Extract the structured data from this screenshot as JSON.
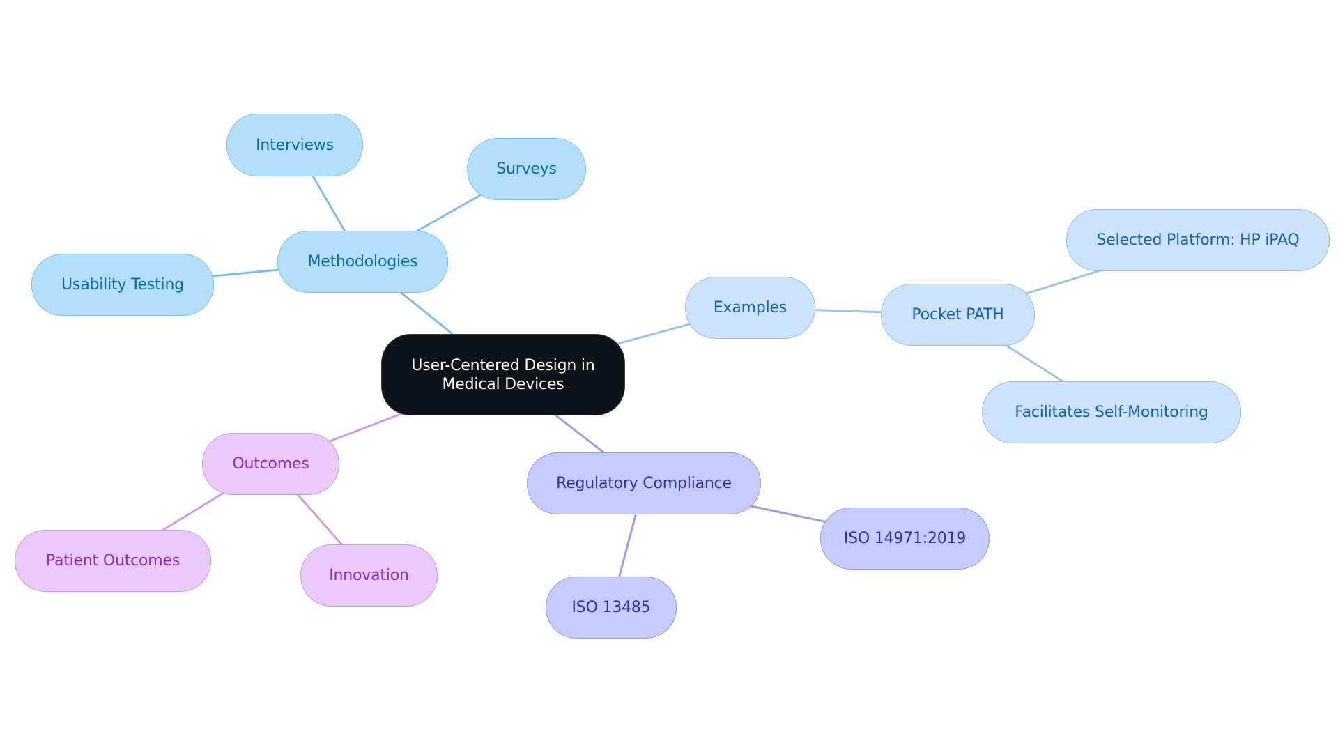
{
  "diagram": {
    "type": "mind-map",
    "root": {
      "id": "root",
      "label": "User-Centered Design in Medical Devices"
    },
    "colors": {
      "root_fill": "#0d131a",
      "methodologies_branch": "#b3dffc",
      "methodologies_edge": "#7fbde8",
      "examples_branch": "#cce3fb",
      "examples_edge": "#9cc3ea",
      "regulatory_branch": "#c7cafd",
      "regulatory_edge": "#9a9fe6",
      "outcomes_branch": "#eac9fd",
      "outcomes_edge": "#cf9ced"
    },
    "branches": [
      {
        "id": "methodologies",
        "label": "Methodologies",
        "color": "blue1",
        "children": [
          {
            "id": "interviews",
            "label": "Interviews"
          },
          {
            "id": "surveys",
            "label": "Surveys"
          },
          {
            "id": "usability",
            "label": "Usability Testing"
          }
        ]
      },
      {
        "id": "examples",
        "label": "Examples",
        "color": "blue2",
        "children": [
          {
            "id": "pocketpath",
            "label": "Pocket PATH",
            "children": [
              {
                "id": "platform",
                "label": "Selected Platform: HP iPAQ"
              },
              {
                "id": "selfmon",
                "label": "Facilitates Self-Monitoring"
              }
            ]
          }
        ]
      },
      {
        "id": "regulatory",
        "label": "Regulatory Compliance",
        "color": "indigo",
        "children": [
          {
            "id": "iso14971",
            "label": "ISO 14971:2019"
          },
          {
            "id": "iso13485",
            "label": "ISO 13485"
          }
        ]
      },
      {
        "id": "outcomes",
        "label": "Outcomes",
        "color": "purple",
        "children": [
          {
            "id": "patient",
            "label": "Patient Outcomes"
          },
          {
            "id": "innovation",
            "label": "Innovation"
          }
        ]
      }
    ]
  }
}
